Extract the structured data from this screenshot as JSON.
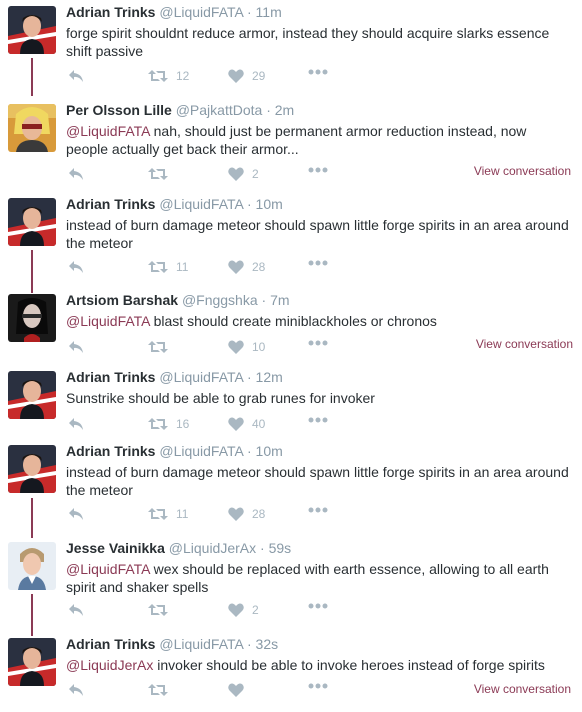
{
  "tweets": [
    {
      "name": "Adrian Trinks",
      "handle": "@LiquidFATA",
      "sep": "·",
      "time": "11m",
      "mention": "",
      "text": "forge spirit shouldnt reduce armor, instead they should acquire slarks essence shift passive",
      "retweets": "12",
      "likes": "29",
      "view_conversation": ""
    },
    {
      "name": "Per Olsson Lille",
      "handle": "@PajkattDota",
      "sep": "·",
      "time": "2m",
      "mention": "@LiquidFATA",
      "text": " nah, should just be permanent armor reduction instead, now people actually get back their armor...",
      "retweets": "",
      "likes": "2",
      "view_conversation": "View conversation"
    },
    {
      "name": "Adrian Trinks",
      "handle": "@LiquidFATA",
      "sep": "·",
      "time": "10m",
      "mention": "",
      "text": "instead of burn damage meteor should spawn little forge spirits in an area around the meteor",
      "retweets": "11",
      "likes": "28",
      "view_conversation": ""
    },
    {
      "name": "Artsiom Barshak",
      "handle": "@Fnggshka",
      "sep": "·",
      "time": "7m",
      "mention": "@LiquidFATA",
      "text": " blast should create miniblackholes or chronos",
      "retweets": "",
      "likes": "10",
      "view_conversation": "View conversation"
    },
    {
      "name": "Adrian Trinks",
      "handle": "@LiquidFATA",
      "sep": "·",
      "time": "12m",
      "mention": "",
      "text": "Sunstrike should be able to grab runes for invoker",
      "retweets": "16",
      "likes": "40",
      "view_conversation": ""
    },
    {
      "name": "Adrian Trinks",
      "handle": "@LiquidFATA",
      "sep": "·",
      "time": "10m",
      "mention": "",
      "text": "instead of burn damage meteor should spawn little forge spirits in an area around the meteor",
      "retweets": "11",
      "likes": "28",
      "view_conversation": ""
    },
    {
      "name": "Jesse Vainikka",
      "handle": "@LiquidJerAx",
      "sep": "·",
      "time": "59s",
      "mention": "@LiquidFATA",
      "text": " wex should be replaced with earth essence, allowing to all earth spirit and shaker spells",
      "retweets": "",
      "likes": "2",
      "view_conversation": ""
    },
    {
      "name": "Adrian Trinks",
      "handle": "@LiquidFATA",
      "sep": "·",
      "time": "32s",
      "mention": "@LiquidJerAx",
      "text": " invoker should be able to invoke heroes instead of forge spirits",
      "retweets": "",
      "likes": "",
      "view_conversation": "View conversation"
    }
  ],
  "colors": {
    "link": "#8b3a55",
    "icon": "#aab8c2",
    "muted": "#8899a6"
  },
  "icons": [
    "reply-icon",
    "retweet-icon",
    "heart-icon",
    "more-icon"
  ]
}
